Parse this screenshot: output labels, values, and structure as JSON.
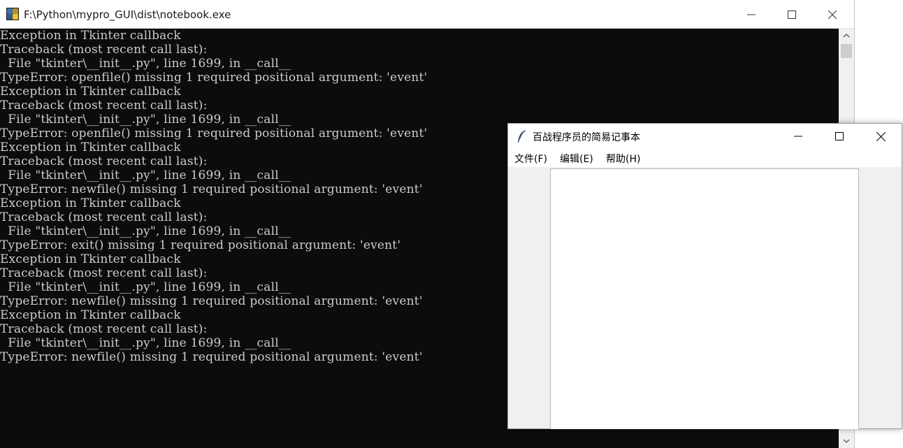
{
  "console": {
    "title": "F:\\Python\\mypro_GUI\\dist\\notebook.exe",
    "lines": [
      "Exception in Tkinter callback",
      "Traceback (most recent call last):",
      "  File \"tkinter\\__init__.py\", line 1699, in __call__",
      "TypeError: openfile() missing 1 required positional argument: 'event'",
      "Exception in Tkinter callback",
      "Traceback (most recent call last):",
      "  File \"tkinter\\__init__.py\", line 1699, in __call__",
      "TypeError: openfile() missing 1 required positional argument: 'event'",
      "Exception in Tkinter callback",
      "Traceback (most recent call last):",
      "  File \"tkinter\\__init__.py\", line 1699, in __call__",
      "TypeError: newfile() missing 1 required positional argument: 'event'",
      "Exception in Tkinter callback",
      "Traceback (most recent call last):",
      "  File \"tkinter\\__init__.py\", line 1699, in __call__",
      "TypeError: exit() missing 1 required positional argument: 'event'",
      "Exception in Tkinter callback",
      "Traceback (most recent call last):",
      "  File \"tkinter\\__init__.py\", line 1699, in __call__",
      "TypeError: newfile() missing 1 required positional argument: 'event'",
      "Exception in Tkinter callback",
      "Traceback (most recent call last):",
      "  File \"tkinter\\__init__.py\", line 1699, in __call__",
      "TypeError: newfile() missing 1 required positional argument: 'event'"
    ]
  },
  "notepad": {
    "title": "百战程序员的简易记事本",
    "menu": {
      "file": "文件(F)",
      "edit": "编辑(E)",
      "help": "帮助(H)"
    },
    "text_content": ""
  },
  "icons": {
    "console_app": "python-exe-icon",
    "notepad_app": "tk-feather-icon",
    "minimize": "minimize-icon",
    "maximize": "maximize-icon",
    "close": "close-icon"
  },
  "colors": {
    "console_bg": "#0c0c0c",
    "console_text": "#cccccc",
    "window_chrome": "#ffffff",
    "notepad_bg": "#f0f0f0"
  }
}
